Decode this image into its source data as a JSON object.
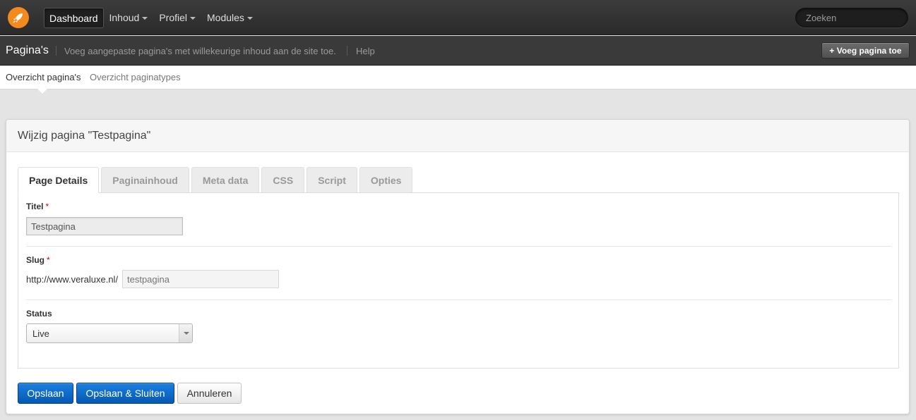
{
  "topnav": {
    "logo_icon": "rocket-icon",
    "items": [
      {
        "label": "Dashboard",
        "active": true,
        "dropdown": false
      },
      {
        "label": "Inhoud",
        "active": false,
        "dropdown": true
      },
      {
        "label": "Profiel",
        "active": false,
        "dropdown": true
      },
      {
        "label": "Modules",
        "active": false,
        "dropdown": true
      }
    ],
    "search_placeholder": "Zoeken"
  },
  "pagebar": {
    "title": "Pagina's",
    "description": "Voeg aangepaste pagina's met willekeurige inhoud aan de site toe.",
    "help": "Help",
    "add_button": "+ Voeg pagina toe"
  },
  "subnav": {
    "items": [
      {
        "label": "Overzicht pagina's",
        "active": true
      },
      {
        "label": "Overzicht paginatypes",
        "active": false
      }
    ]
  },
  "panel": {
    "title": "Wijzig pagina \"Testpagina\"",
    "tabs": [
      {
        "label": "Page Details",
        "active": true
      },
      {
        "label": "Paginainhoud",
        "active": false
      },
      {
        "label": "Meta data",
        "active": false
      },
      {
        "label": "CSS",
        "active": false
      },
      {
        "label": "Script",
        "active": false
      },
      {
        "label": "Opties",
        "active": false
      }
    ],
    "fields": {
      "title_label": "Titel",
      "title_value": "Testpagina",
      "slug_label": "Slug",
      "slug_prefix": "http://www.veraluxe.nl/",
      "slug_placeholder": "testpagina",
      "status_label": "Status",
      "status_value": "Live",
      "required_marker": "*"
    },
    "buttons": {
      "save": "Opslaan",
      "save_close": "Opslaan & Sluiten",
      "cancel": "Annuleren"
    }
  }
}
